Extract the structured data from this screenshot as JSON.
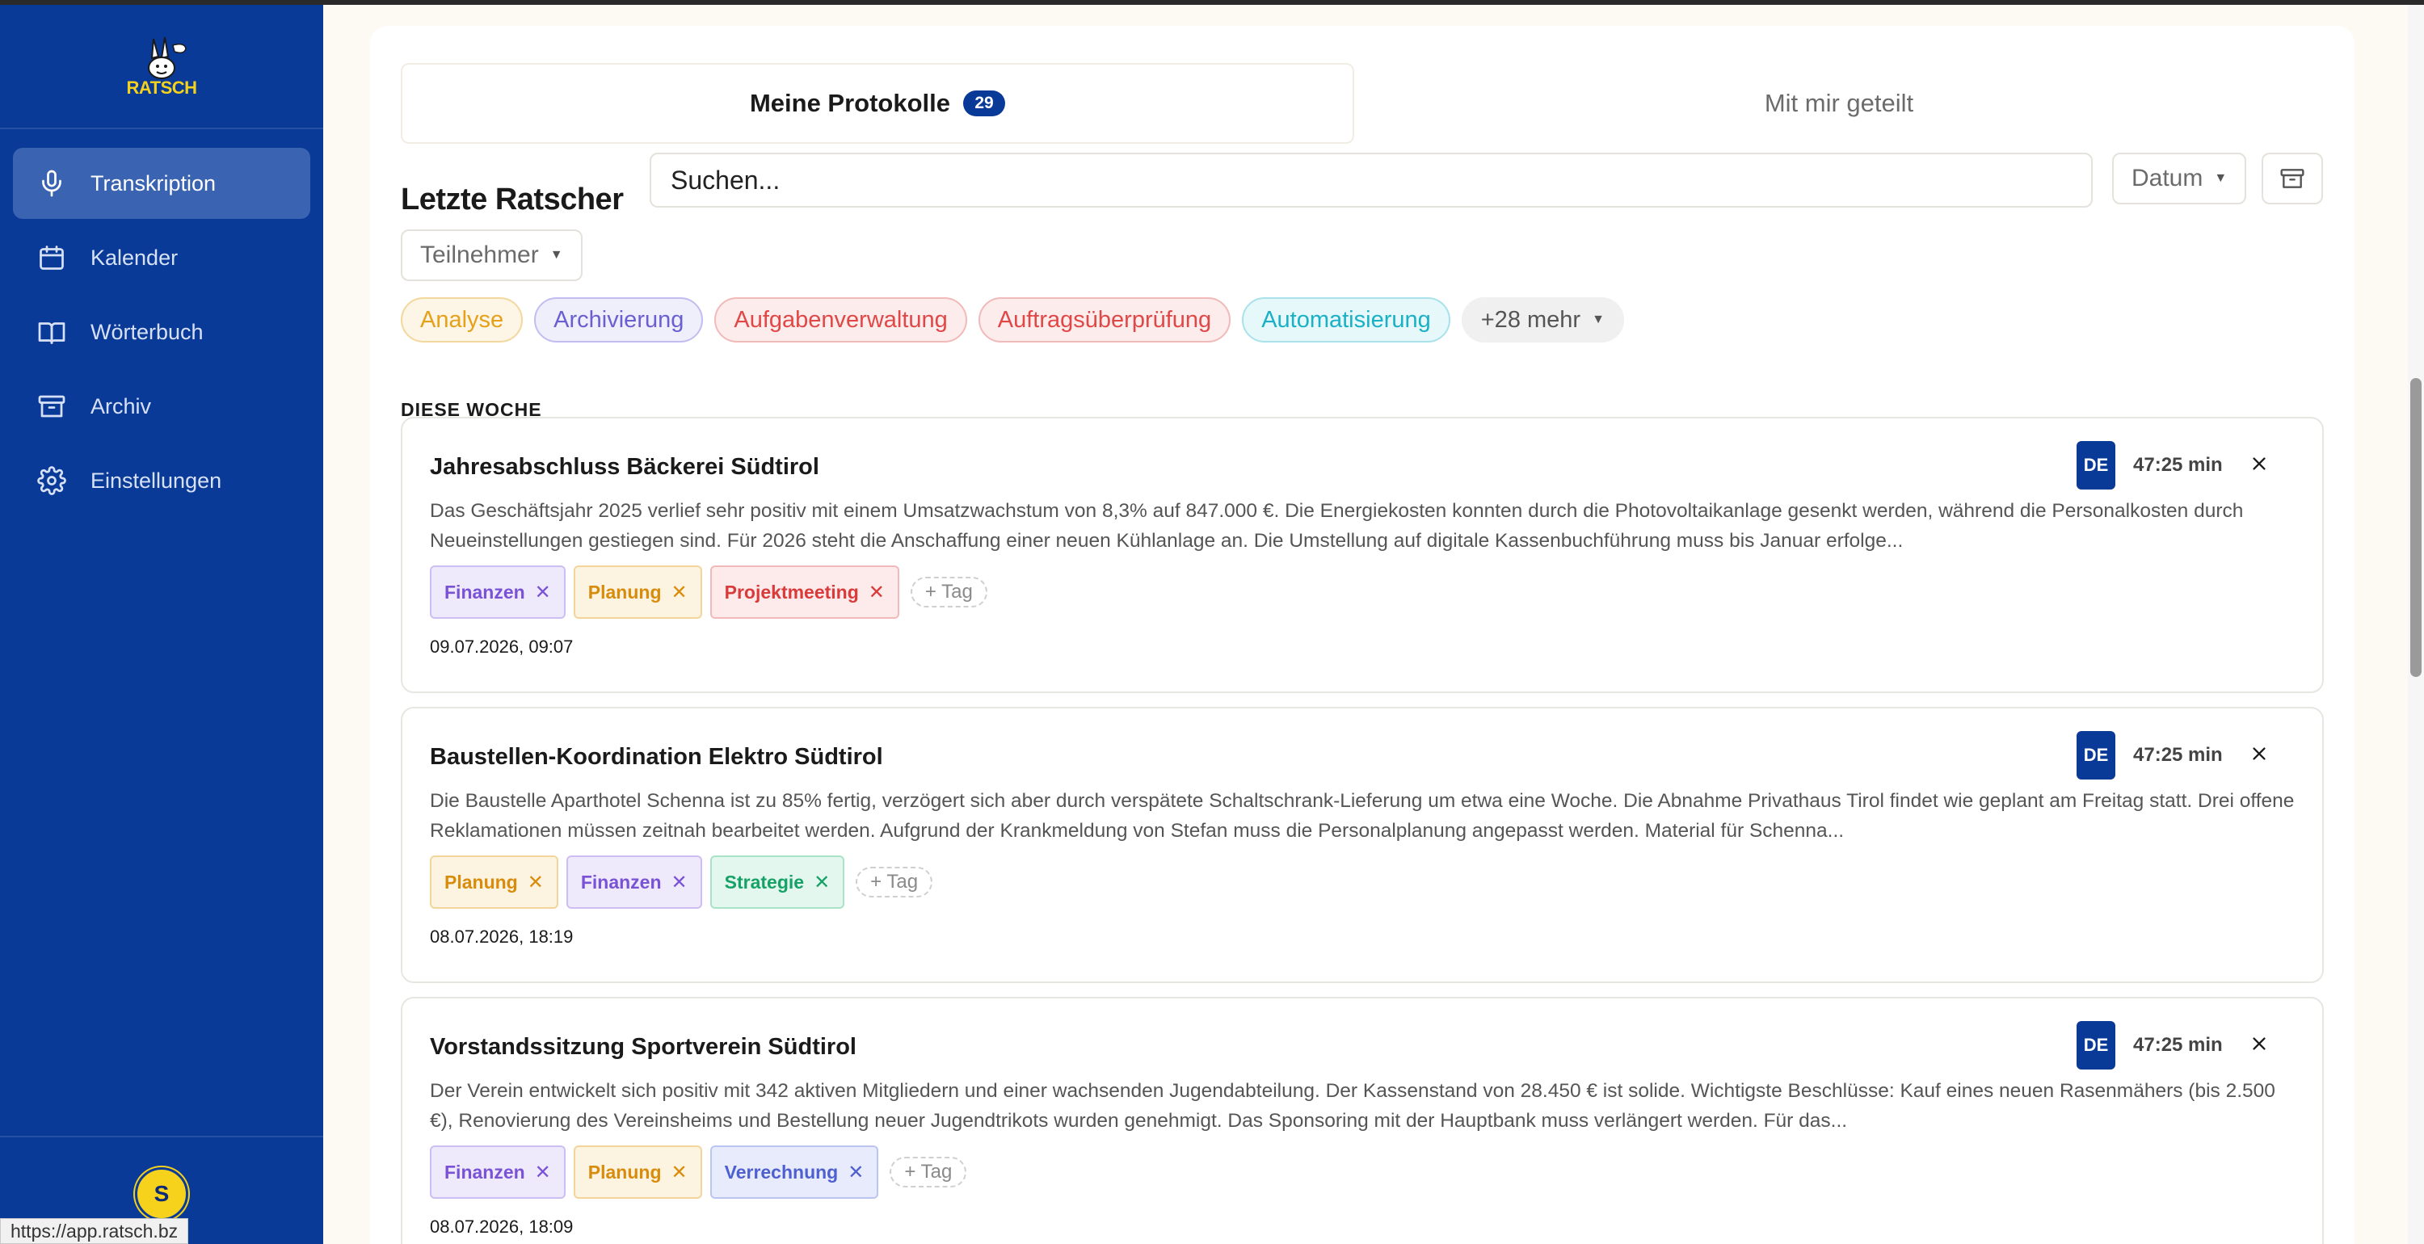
{
  "app": {
    "logo_text": "RATSCH",
    "user_initial": "S",
    "status_url": "https://app.ratsch.bz"
  },
  "sidebar": {
    "items": [
      {
        "label": "Transkription",
        "icon": "microphone-icon",
        "active": true
      },
      {
        "label": "Kalender",
        "icon": "calendar-icon",
        "active": false
      },
      {
        "label": "Wörterbuch",
        "icon": "book-icon",
        "active": false
      },
      {
        "label": "Archiv",
        "icon": "archive-icon",
        "active": false
      },
      {
        "label": "Einstellungen",
        "icon": "gear-icon",
        "active": false
      }
    ]
  },
  "tabs": {
    "mine": {
      "label": "Meine Protokolle",
      "count": "29"
    },
    "shared": {
      "label": "Mit mir geteilt"
    }
  },
  "toolbar": {
    "title": "Letzte Ratscher",
    "search_placeholder": "Suchen...",
    "date_filter": "Datum",
    "participants_filter": "Teilnehmer"
  },
  "filters": {
    "chips": [
      {
        "label": "Analyse",
        "color": "#e6a01a"
      },
      {
        "label": "Archivierung",
        "color": "#6a5fd0"
      },
      {
        "label": "Aufgabenverwaltung",
        "color": "#e04848"
      },
      {
        "label": "Auftragsüberprüfung",
        "color": "#e04848"
      },
      {
        "label": "Automatisierung",
        "color": "#1ab0c6"
      }
    ],
    "more_label": "+28 mehr"
  },
  "group": {
    "label": "DIESE WOCHE"
  },
  "tag_add_label": "+ Tag",
  "cards": [
    {
      "title": "Jahresabschluss Bäckerei Südtirol",
      "language": "DE",
      "duration": "47:25 min",
      "text": "Das Geschäftsjahr 2025 verlief sehr positiv mit einem Umsatzwachstum von 8,3% auf 847.000 €. Die Energiekosten konnten durch die Photovoltaikanlage gesenkt werden, während die Personalkosten durch Neueinstellungen gestiegen sind. Für 2026 steht die Anschaffung einer neuen Kühlanlage an. Die Umstellung auf digitale Kassenbuchführung muss bis Januar erfolge...",
      "tags": [
        {
          "label": "Finanzen",
          "kind": "purple"
        },
        {
          "label": "Planung",
          "kind": "orange"
        },
        {
          "label": "Projektmeeting",
          "kind": "red"
        }
      ],
      "date": "09.07.2026, 09:07"
    },
    {
      "title": "Baustellen-Koordination Elektro Südtirol",
      "language": "DE",
      "duration": "47:25 min",
      "text": "Die Baustelle Aparthotel Schenna ist zu 85% fertig, verzögert sich aber durch verspätete Schaltschrank-Lieferung um etwa eine Woche. Die Abnahme Privathaus Tirol findet wie geplant am Freitag statt. Drei offene Reklamationen müssen zeitnah bearbeitet werden. Aufgrund der Krankmeldung von Stefan muss die Personalplanung angepasst werden. Material für Schenna...",
      "tags": [
        {
          "label": "Planung",
          "kind": "orange"
        },
        {
          "label": "Finanzen",
          "kind": "purple"
        },
        {
          "label": "Strategie",
          "kind": "green"
        }
      ],
      "date": "08.07.2026, 18:19"
    },
    {
      "title": "Vorstandssitzung Sportverein Südtirol",
      "language": "DE",
      "duration": "47:25 min",
      "text": "Der Verein entwickelt sich positiv mit 342 aktiven Mitgliedern und einer wachsenden Jugendabteilung. Der Kassenstand von 28.450 € ist solide. Wichtigste Beschlüsse: Kauf eines neuen Rasenmähers (bis 2.500 €), Renovierung des Vereinsheims und Bestellung neuer Jugendtrikots wurden genehmigt. Das Sponsoring mit der Hauptbank muss verlängert werden. Für das...",
      "tags": [
        {
          "label": "Finanzen",
          "kind": "purple"
        },
        {
          "label": "Planung",
          "kind": "orange"
        },
        {
          "label": "Verrechnung",
          "kind": "indigo"
        }
      ],
      "date": "08.07.2026, 18:09"
    }
  ],
  "colors": {
    "sidebar_bg": "#0a3a98",
    "sidebar_active": "#3a64b2",
    "accent": "#0a3a98",
    "page_bg": "#fdfaf3",
    "logo_yellow": "#f4d21b"
  },
  "tag_styles": {
    "purple": {
      "bg": "#efe9fc",
      "border": "#cdbef3",
      "color": "#7a52d6"
    },
    "orange": {
      "bg": "#fdf3e1",
      "border": "#f3d59c",
      "color": "#d98c0b"
    },
    "red": {
      "bg": "#fdeaea",
      "border": "#f1b9b9",
      "color": "#d93a3a"
    },
    "green": {
      "bg": "#e4f7ee",
      "border": "#a9e3c6",
      "color": "#16a266"
    },
    "indigo": {
      "bg": "#e8ebfb",
      "border": "#bcc5f1",
      "color": "#4e5fcf"
    }
  }
}
